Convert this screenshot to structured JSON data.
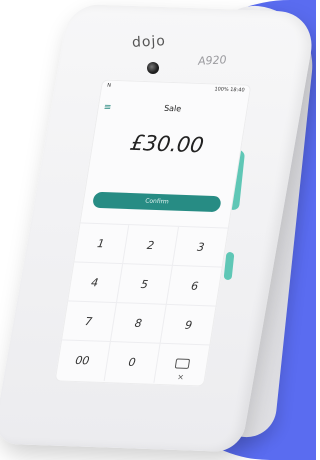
{
  "device": {
    "brand": "dojo",
    "model": "A920"
  },
  "status_bar": {
    "left": "N",
    "right": "100% 18:40"
  },
  "app": {
    "title": "Sale",
    "amount": "£30.00",
    "confirm_label": "Confirm",
    "menu_icon": "hamburger-menu-icon"
  },
  "keypad": {
    "keys": [
      "1",
      "2",
      "3",
      "4",
      "5",
      "6",
      "7",
      "8",
      "9",
      "00",
      "0"
    ],
    "backspace_icon": "backspace-icon"
  },
  "colors": {
    "accent": "#278c84",
    "backdrop": "#5a6cf0",
    "side_trim": "#5fc7b6"
  }
}
